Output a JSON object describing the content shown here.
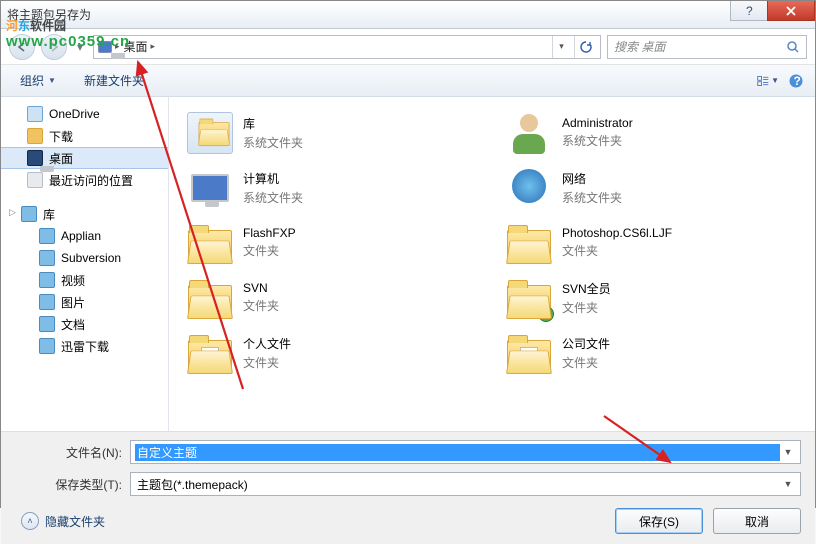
{
  "window": {
    "title": "将主题包另存为"
  },
  "watermark": {
    "line1_a": "河",
    "line1_b": "东",
    "line1_c": "软件园",
    "line2": "www.pc0359.cn"
  },
  "nav": {
    "back_hint": "back",
    "fwd_hint": "forward",
    "address_seg": "桌面",
    "refresh_hint": "refresh",
    "search_placeholder": "搜索 桌面"
  },
  "toolbar": {
    "organize": "组织",
    "new_folder": "新建文件夹"
  },
  "tree": {
    "onedrive": "OneDrive",
    "downloads": "下载",
    "desktop": "桌面",
    "recent": "最近访问的位置",
    "libraries": "库",
    "applian": "Applian",
    "subversion": "Subversion",
    "videos": "视频",
    "pictures": "图片",
    "documents": "文档",
    "xunlei": "迅雷下载"
  },
  "types": {
    "sysfolder": "系统文件夹",
    "folder": "文件夹"
  },
  "items": [
    {
      "name": "库",
      "typekey": "sysfolder",
      "kind": "lib"
    },
    {
      "name": "Administrator",
      "typekey": "sysfolder",
      "kind": "user"
    },
    {
      "name": "计算机",
      "typekey": "sysfolder",
      "kind": "comp"
    },
    {
      "name": "网络",
      "typekey": "sysfolder",
      "kind": "net"
    },
    {
      "name": "FlashFXP",
      "typekey": "folder",
      "kind": "folder"
    },
    {
      "name": "Photoshop.CS6l.LJF",
      "typekey": "folder",
      "kind": "folder"
    },
    {
      "name": "SVN",
      "typekey": "folder",
      "kind": "folder"
    },
    {
      "name": "SVN全员",
      "typekey": "folder",
      "kind": "folder-chk"
    },
    {
      "name": "个人文件",
      "typekey": "folder",
      "kind": "folder-doc"
    },
    {
      "name": "公司文件",
      "typekey": "folder",
      "kind": "folder-doc"
    }
  ],
  "form": {
    "filename_label": "文件名(N):",
    "filename_value": "自定义主题",
    "type_label": "保存类型(T):",
    "type_value": "主题包(*.themepack)",
    "hide_folders": "隐藏文件夹",
    "save": "保存(S)",
    "cancel": "取消"
  }
}
